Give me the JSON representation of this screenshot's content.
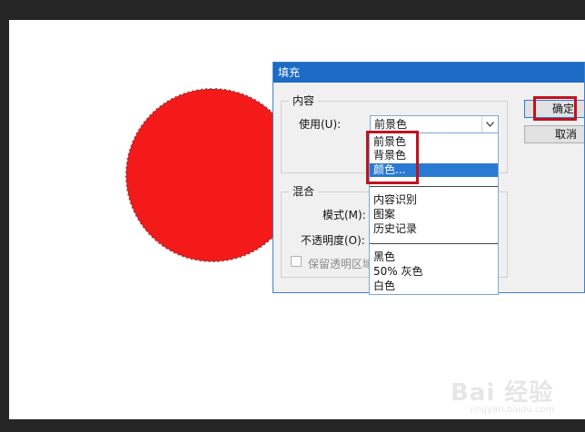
{
  "dialog": {
    "title": "填充",
    "content_group": {
      "title": "内容",
      "use_label": "使用(U):",
      "use_value": "前景色"
    },
    "blend_group": {
      "title": "混合",
      "mode_label": "模式(M):",
      "opacity_label": "不透明度(O):",
      "preserve_label": "保留透明区域"
    },
    "ok_label": "确定",
    "cancel_label": "取消"
  },
  "dropdown": {
    "options": [
      "前景色",
      "背景色",
      "颜色...",
      "内容识别",
      "图案",
      "历史记录",
      "黑色",
      "50% 灰色",
      "白色"
    ],
    "selected": "颜色..."
  },
  "watermark": {
    "brand": "Bai 经验",
    "url": "jingyan.baidu.com"
  },
  "colors": {
    "fill_circle": "#f51a1a",
    "highlight": "#c1121f",
    "selection": "#2a7ad4"
  }
}
